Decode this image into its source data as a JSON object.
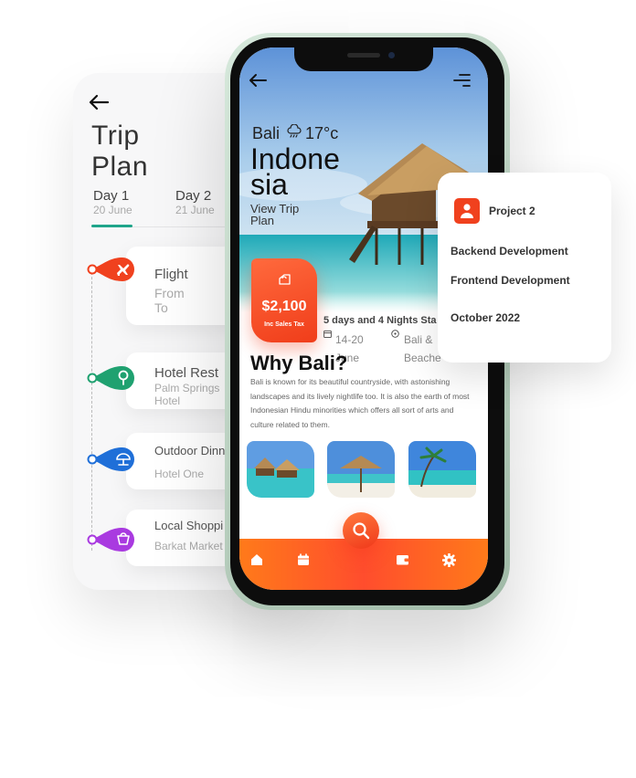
{
  "trip_plan": {
    "title_line1": "Trip",
    "title_line2": "Plan",
    "days": [
      {
        "label": "Day 1",
        "date": "20 June"
      },
      {
        "label": "Day 2",
        "date": "21 June"
      }
    ],
    "events": [
      {
        "title": "Flight",
        "line1": "From",
        "line2": "To",
        "icon": "airplane-icon",
        "color": "#f0411e"
      },
      {
        "title": "Hotel Rest",
        "line1": "Palm Springs",
        "line2": "Hotel",
        "icon": "tree-icon",
        "color": "#1fa170"
      },
      {
        "title": "Outdoor Dinn",
        "line1": "Hotel One",
        "icon": "umbrella-icon",
        "color": "#1f6fd8"
      },
      {
        "title": "Local Shoppi",
        "line1": "Barkat Market",
        "icon": "shopping-bag-icon",
        "color": "#a93ae0"
      }
    ]
  },
  "phone": {
    "location": "Bali",
    "temperature": "17°c",
    "country_line1": "Indone",
    "country_line2": "sia",
    "view_line1": "View Trip",
    "view_line2": "Plan",
    "price": "$2,100",
    "price_note": "Inc Sales Tax",
    "duration": "5 days and 4 Nights Sta",
    "dates_line1": "14-20",
    "dates_line2": "June",
    "place_line1": "Bali &",
    "place_line2": "Beache",
    "why_title": "Why Bali?",
    "description": "Bali is known for its beautiful countryside, with astonishing landscapes and its lively nightlife too. It is also the earth of most Indonesian Hindu minorities which offers all sort of arts and culture related to them.",
    "nav": [
      "home-icon",
      "calendar-icon",
      "search-icon",
      "wallet-icon",
      "settings-icon"
    ]
  },
  "project_card": {
    "title": "Project 2",
    "items": [
      "Backend Development",
      "Frontend Development"
    ],
    "date": "October 2022",
    "accent": "#f0411e"
  }
}
